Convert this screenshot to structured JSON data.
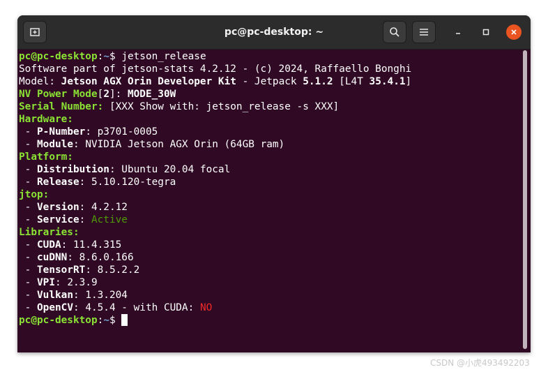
{
  "window": {
    "title": "pc@pc-desktop: ~"
  },
  "icons": {
    "new_tab": "new-tab-icon",
    "search": "search-icon",
    "menu": "hamburger-menu-icon",
    "minimize": "minimize-icon",
    "maximize": "maximize-icon",
    "close": "close-icon"
  },
  "colors": {
    "terminal_bg": "#300a24",
    "prompt_user": "#8ae234",
    "prompt_path": "#729fcf",
    "active": "#4e9a06",
    "no": "#ef2929",
    "close_button": "#e95420"
  },
  "terminal": {
    "prompt": {
      "user_host": "pc@pc-desktop",
      "colon": ":",
      "path": "~",
      "symbol": "$ "
    },
    "command": "jetson_release",
    "line_software": "Software part of jetson-stats 4.2.12 - (c) 2024, Raffaello Bonghi",
    "model": {
      "label": "Model: ",
      "name": "Jetson AGX Orin Developer Kit",
      "sep": " - Jetpack ",
      "jetpack": "5.1.2",
      "l4t_open": " [L4T ",
      "l4t": "35.4.1",
      "l4t_close": "]"
    },
    "power_mode": {
      "label": "NV Power Mode",
      "bracket_open": "[",
      "index": "2",
      "bracket_close": "]: ",
      "value": "MODE_30W"
    },
    "serial": {
      "label": "Serial Number: ",
      "value": "[XXX Show with: jetson_release -s XXX]"
    },
    "hardware": {
      "header": "Hardware:",
      "items": [
        {
          "key": "P-Number",
          "value": "p3701-0005"
        },
        {
          "key": "Module",
          "value": "NVIDIA Jetson AGX Orin (64GB ram)"
        }
      ]
    },
    "platform": {
      "header": "Platform:",
      "items": [
        {
          "key": "Distribution",
          "value": "Ubuntu 20.04 focal"
        },
        {
          "key": "Release",
          "value": "5.10.120-tegra"
        }
      ]
    },
    "jtop": {
      "header": "jtop:",
      "version": {
        "key": "Version",
        "value": "4.2.12"
      },
      "service": {
        "key": "Service",
        "value": "Active"
      }
    },
    "libraries": {
      "header": "Libraries:",
      "items": [
        {
          "key": "CUDA",
          "value": "11.4.315"
        },
        {
          "key": "cuDNN",
          "value": "8.6.0.166"
        },
        {
          "key": "TensorRT",
          "value": "8.5.2.2"
        },
        {
          "key": "VPI",
          "value": "2.3.9"
        },
        {
          "key": "Vulkan",
          "value": "1.3.204"
        }
      ],
      "opencv": {
        "key": "OpenCV",
        "value": "4.5.4 - with CUDA: ",
        "cuda": "NO"
      }
    }
  },
  "watermark": "CSDN @小虎493492203"
}
